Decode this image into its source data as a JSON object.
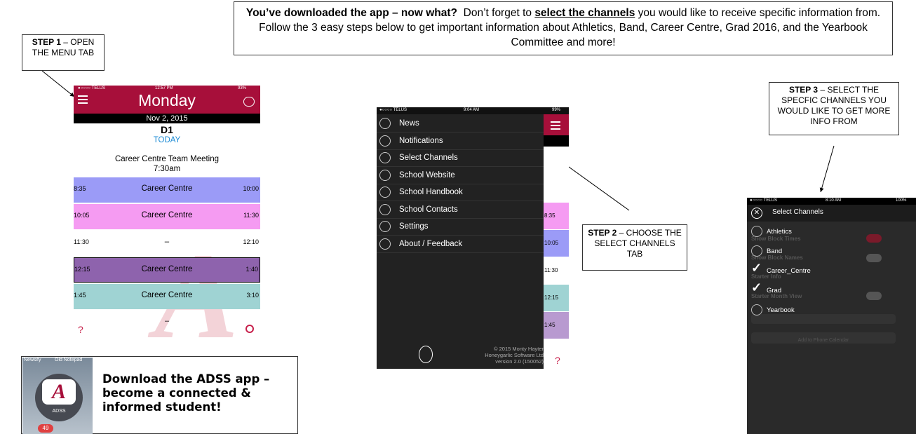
{
  "header": {
    "bold_intro": "You’ve downloaded the app – now what?",
    "part1": "Don’t forget to",
    "underlined": "select the channels",
    "part2": "you would like to receive specific information from.  Follow the 3 easy steps below to get important information about Athletics, Band, Career Centre, Grad 2016, and the Yearbook Committee and more!"
  },
  "step1": {
    "bold": "STEP 1",
    "text": "– OPEN THE MENU TAB"
  },
  "step2": {
    "bold": "STEP 2",
    "text": "– CHOOSE THE SELECT CHANNELS TAB"
  },
  "step3": {
    "bold": "STEP 3",
    "text": "– SELECT THE SPECFIC CHANNELS YOU WOULD LIKE TO GET MORE INFO FROM"
  },
  "phone1": {
    "status": {
      "carrier": "●○○○○ TELUS",
      "time": "12:57 PM",
      "battery": "93%"
    },
    "title": "Monday",
    "date": "Nov 2, 2015",
    "day_code": "D1",
    "today_link": "TODAY",
    "event": {
      "title": "Career Centre Team Meeting",
      "time": "7:30am"
    },
    "blocks": [
      {
        "start": "8:35",
        "end": "10:00",
        "label": "Career Centre",
        "color": "#9b9bf7"
      },
      {
        "start": "10:05",
        "end": "11:30",
        "label": "Career Centre",
        "color": "#f59bf2"
      },
      {
        "start": "11:30",
        "end": "12:10",
        "label": "–",
        "color": "#ffffff"
      },
      {
        "start": "12:15",
        "end": "1:40",
        "label": "Career Centre",
        "color": "#8e63ad"
      },
      {
        "start": "1:45",
        "end": "3:10",
        "label": "Career Centre",
        "color": "#9fd3d3"
      }
    ],
    "after_dash": "–",
    "help": "?",
    "accent": "#a70f3a"
  },
  "appbox": {
    "bg_label_1": "Newsify",
    "bg_label_2": "Old Notepad",
    "icon_letter": "A",
    "icon_label": "ADSS",
    "badge": "49",
    "text": "Download the ADSS app – become a connected & informed student!"
  },
  "phone2": {
    "status": {
      "carrier": "●○○○○ TELUS",
      "time": "9:04 AM",
      "battery": "99%"
    },
    "menu": [
      {
        "label": "News",
        "icon": "news-icon"
      },
      {
        "label": "Notifications",
        "icon": "warning-icon"
      },
      {
        "label": "Select Channels",
        "icon": "channels-icon"
      },
      {
        "label": "School Website",
        "icon": "globe-icon"
      },
      {
        "label": "School Handbook",
        "icon": "book-icon"
      },
      {
        "label": "School Contacts",
        "icon": "contacts-icon"
      },
      {
        "label": "Settings",
        "icon": "settings-icon"
      },
      {
        "label": "About / Feedback",
        "icon": "help-icon"
      }
    ],
    "strip": [
      {
        "time": "8:35",
        "color": "#f59bf2"
      },
      {
        "time": "10:05",
        "color": "#9b9bf7"
      },
      {
        "time": "11:30",
        "color": "#ffffff"
      },
      {
        "time": "12:15",
        "color": "#9fd3d3"
      },
      {
        "time": "1:45",
        "color": "#b89ad0"
      }
    ],
    "footer": [
      "© 2015 Monty Hayter",
      "Honeygarlic Software Ltd",
      "version 2.0 (150052)"
    ],
    "help": "?"
  },
  "phone3": {
    "status": {
      "carrier": "●○○○○ TELUS",
      "time": "8:10 AM",
      "battery": "100%"
    },
    "title": "Select Channels",
    "channels": [
      {
        "label": "Athletics",
        "checked": false
      },
      {
        "label": "Band",
        "checked": false
      },
      {
        "label": "Career_Centre",
        "checked": true
      },
      {
        "label": "Grad",
        "checked": true
      },
      {
        "label": "Yearbook",
        "checked": false
      }
    ],
    "ghost_rows": [
      "Show Block Times",
      "Show Block Names",
      "Starter Info",
      "Starter Month View"
    ],
    "ghost_button": "Add to Phone Calendar"
  }
}
